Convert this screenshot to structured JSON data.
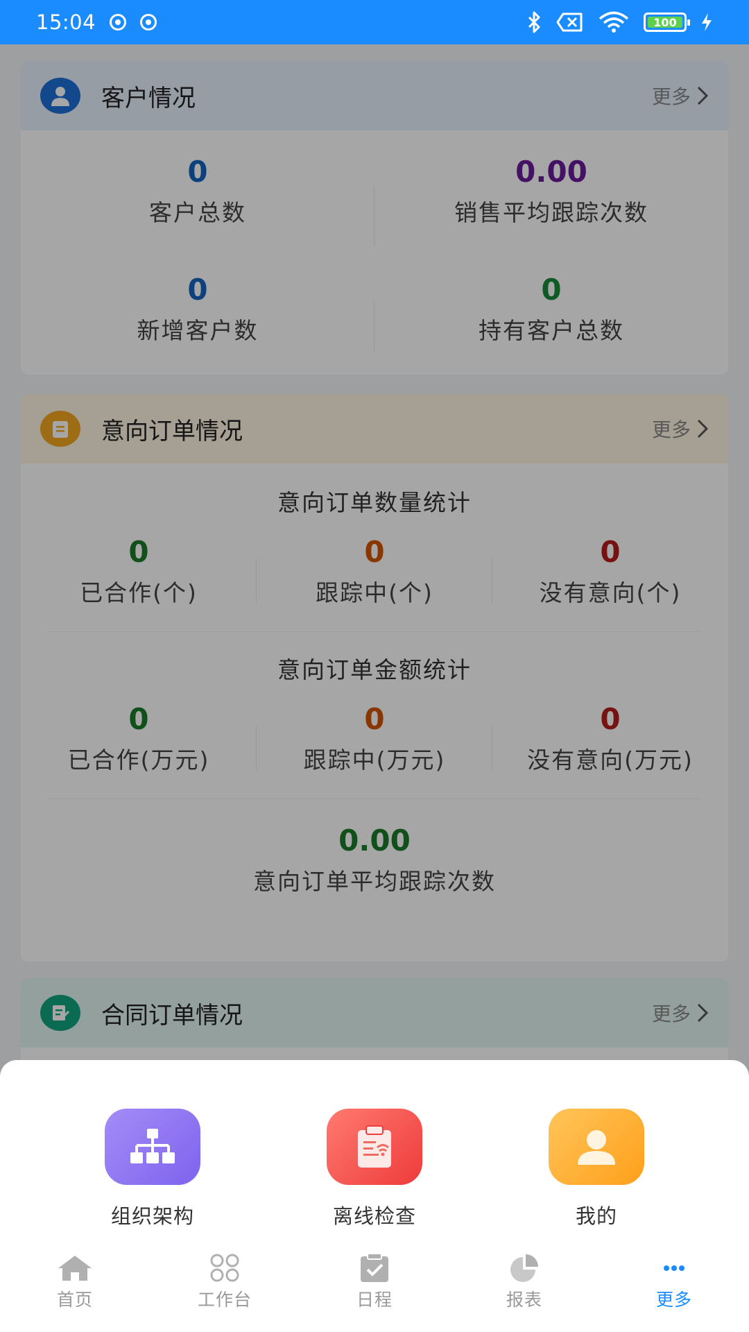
{
  "status_bar": {
    "time": "15:04",
    "battery": "100"
  },
  "cards": {
    "customer": {
      "title": "客户情况",
      "more": "更多",
      "stats": [
        {
          "value": "0",
          "label": "客户总数",
          "color": "#1565c0"
        },
        {
          "value": "0.00",
          "label": "销售平均跟踪次数",
          "color": "#6a1b9a"
        },
        {
          "value": "0",
          "label": "新增客户数",
          "color": "#1565c0"
        },
        {
          "value": "0",
          "label": "持有客户总数",
          "color": "#1b8a3a"
        }
      ]
    },
    "intent": {
      "title": "意向订单情况",
      "more": "更多",
      "count_title": "意向订单数量统计",
      "count_stats": [
        {
          "value": "0",
          "label": "已合作(个)",
          "color": "#1b7a2a"
        },
        {
          "value": "0",
          "label": "跟踪中(个)",
          "color": "#d35400"
        },
        {
          "value": "0",
          "label": "没有意向(个)",
          "color": "#b71c1c"
        }
      ],
      "amount_title": "意向订单金额统计",
      "amount_stats": [
        {
          "value": "0",
          "label": "已合作(万元)",
          "color": "#1b7a2a"
        },
        {
          "value": "0",
          "label": "跟踪中(万元)",
          "color": "#d35400"
        },
        {
          "value": "0",
          "label": "没有意向(万元)",
          "color": "#b71c1c"
        }
      ],
      "avg": {
        "value": "0.00",
        "label": "意向订单平均跟踪次数",
        "color": "#1b7a2a"
      }
    },
    "contract": {
      "title": "合同订单情况",
      "more": "更多"
    }
  },
  "sheet_menu": [
    {
      "label": "组织架构",
      "icon": "org-chart-icon"
    },
    {
      "label": "离线检查",
      "icon": "clipboard-offline-icon"
    },
    {
      "label": "我的",
      "icon": "user-icon"
    }
  ],
  "tabbar": [
    {
      "label": "首页",
      "icon": "home-icon"
    },
    {
      "label": "工作台",
      "icon": "workbench-icon"
    },
    {
      "label": "日程",
      "icon": "schedule-icon"
    },
    {
      "label": "报表",
      "icon": "report-icon"
    },
    {
      "label": "更多",
      "icon": "more-icon",
      "active": true
    }
  ]
}
